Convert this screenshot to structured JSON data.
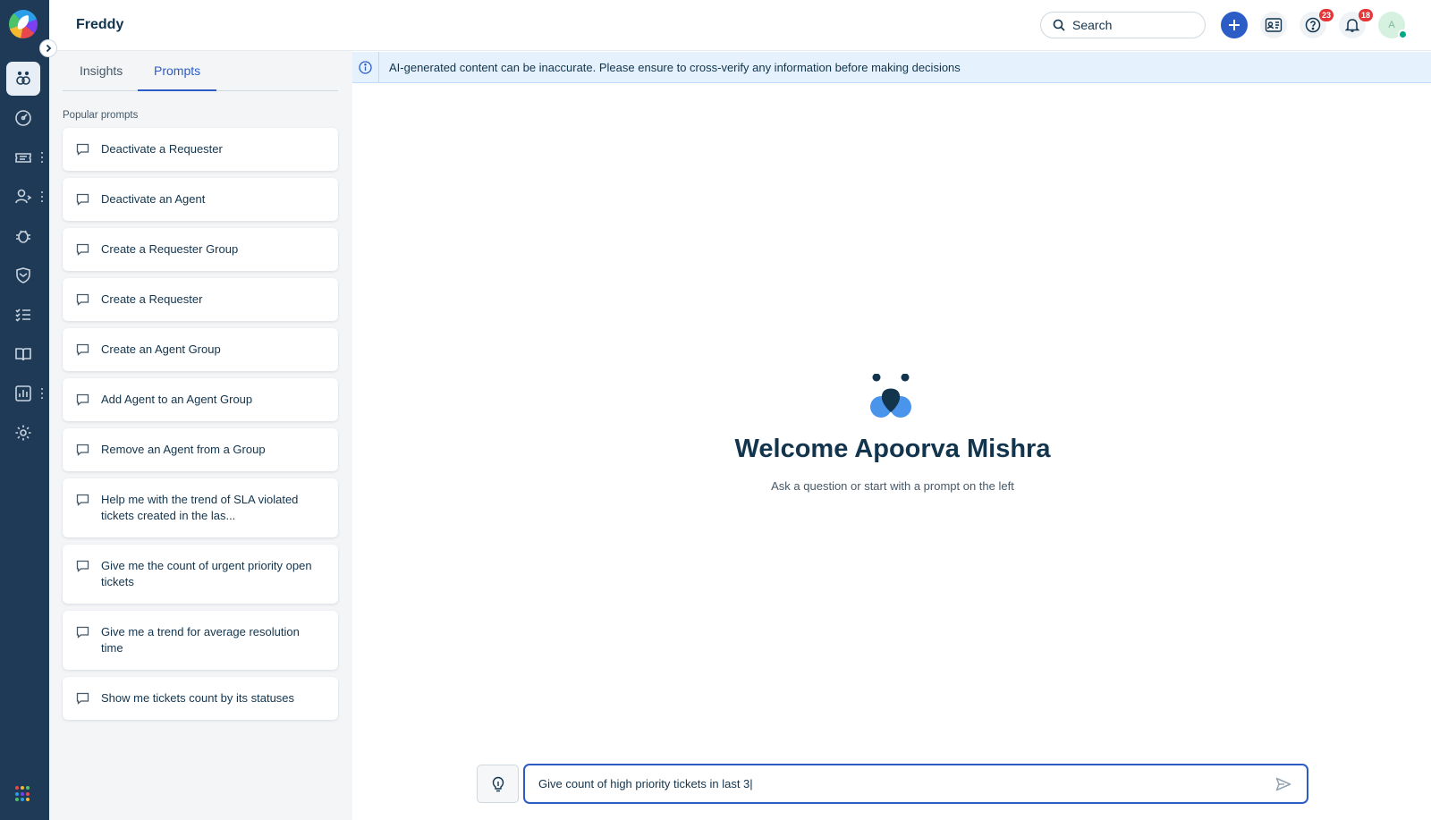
{
  "app": {
    "title": "Freddy"
  },
  "topbar": {
    "search_label": "Search",
    "help_badge": "23",
    "notifications_badge": "18",
    "avatar_initial": "A"
  },
  "panel": {
    "tabs": [
      {
        "label": "Insights",
        "active": false
      },
      {
        "label": "Prompts",
        "active": true
      }
    ],
    "section_label": "Popular prompts",
    "prompts": [
      "Deactivate a Requester",
      "Deactivate an Agent",
      "Create a Requester Group",
      "Create a Requester",
      "Create an Agent Group",
      "Add Agent to an Agent Group",
      "Remove an Agent from a Group",
      "Help me with the trend of SLA violated tickets created in the las...",
      "Give me the count of urgent priority open tickets",
      "Give me a trend for average resolution time",
      "Show me tickets count by its statuses"
    ]
  },
  "banner": {
    "message": "AI-generated content can be inaccurate. Please ensure to cross-verify any information before making decisions"
  },
  "main": {
    "welcome_title": "Welcome Apoorva Mishra",
    "welcome_subtitle": "Ask a question or start with a prompt on the left"
  },
  "composer": {
    "value": "Give count of high priority tickets in last 3|"
  },
  "colors": {
    "rail_bg": "#1f3a56",
    "accent": "#2c5cc5",
    "panel_bg": "#f3f5f7",
    "banner_bg": "#e5f2fd",
    "badge_red": "#e43538",
    "presence_green": "#00a886"
  },
  "icons": {
    "rail": [
      "freddy-icon",
      "dashboard-icon",
      "tickets-icon",
      "contacts-icon",
      "problems-icon",
      "security-icon",
      "tasks-icon",
      "solutions-icon",
      "analytics-icon",
      "settings-icon"
    ]
  }
}
